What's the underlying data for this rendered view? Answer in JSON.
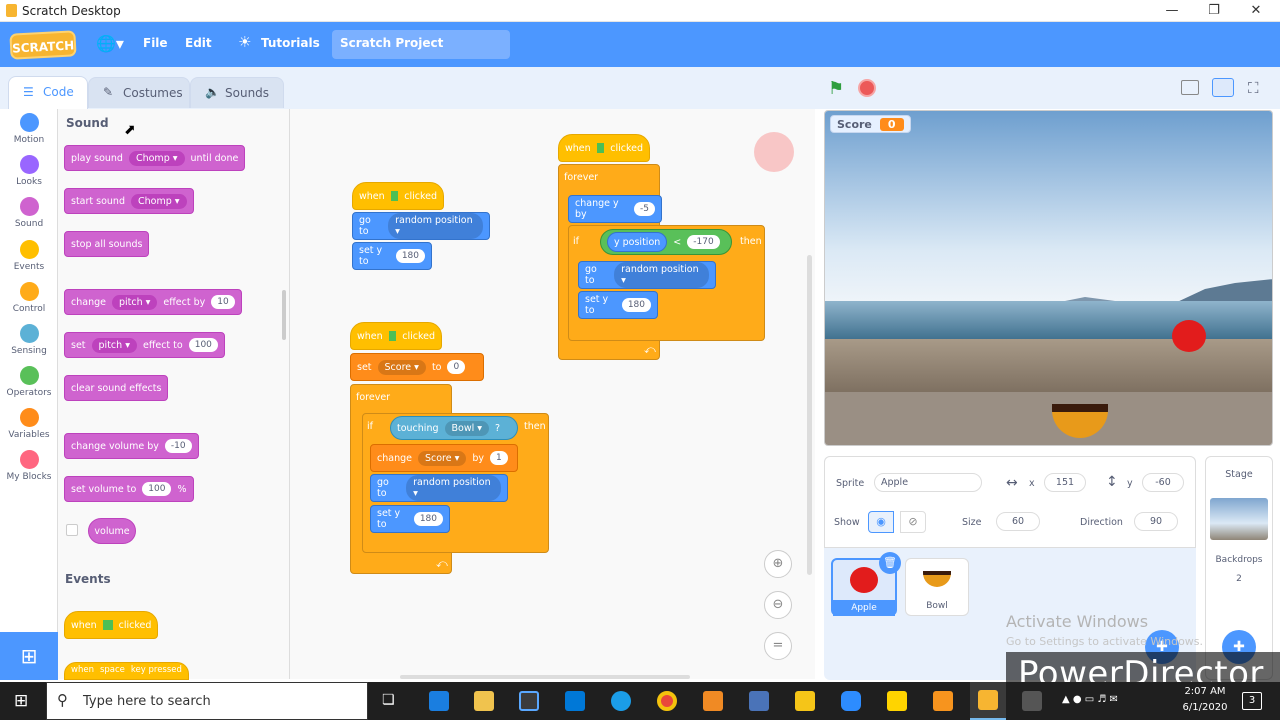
{
  "window": {
    "title": "Scratch Desktop"
  },
  "menubar": {
    "logo": "SCRATCH",
    "file": "File",
    "edit": "Edit",
    "tutorials": "Tutorials",
    "project_title": "Scratch Project"
  },
  "tabs": {
    "code": "Code",
    "costumes": "Costumes",
    "sounds": "Sounds"
  },
  "categories": [
    "Motion",
    "Looks",
    "Sound",
    "Events",
    "Control",
    "Sensing",
    "Operators",
    "Variables",
    "My Blocks"
  ],
  "category_colors": [
    "#4c97ff",
    "#9966ff",
    "#cf63cf",
    "#ffbf00",
    "#ffab19",
    "#5cb1d6",
    "#59c059",
    "#ff8c1a",
    "#ff6680"
  ],
  "palette": {
    "sound_header": "Sound",
    "play_sound": "play sound",
    "chomp": "Chomp",
    "until_done": "until done",
    "start_sound": "start sound",
    "stop_all": "stop all sounds",
    "change": "change",
    "pitch": "pitch",
    "effect_by": "effect by",
    "ten": "10",
    "set": "set",
    "effect_to": "effect to",
    "hundred": "100",
    "clear_effects": "clear sound effects",
    "change_volume_by": "change volume by",
    "minus_ten": "-10",
    "set_volume_to": "set volume to",
    "percent": "%",
    "volume": "volume",
    "events_header": "Events",
    "when": "when",
    "clicked": "clicked",
    "when_space": "when",
    "space": "space",
    "key_pressed": "key pressed"
  },
  "script1": {
    "when": "when",
    "clicked": "clicked",
    "go_to": "go to",
    "random": "random position",
    "set_y": "set y to",
    "y_val": "180"
  },
  "script2": {
    "when": "when",
    "clicked": "clicked",
    "set": "set",
    "score": "Score",
    "to": "to",
    "zero": "0",
    "forever": "forever",
    "if": "if",
    "touching": "touching",
    "bowl": "Bowl",
    "q": "?",
    "then": "then",
    "change": "change",
    "by": "by",
    "one": "1",
    "go_to": "go to",
    "random": "random position",
    "set_y": "set y to",
    "y_val": "180"
  },
  "script3": {
    "when": "when",
    "clicked": "clicked",
    "forever": "forever",
    "change_y": "change y by",
    "minus5": "-5",
    "if": "if",
    "y_position": "y position",
    "lt": "<",
    "minus170": "-170",
    "then": "then",
    "go_to": "go to",
    "random": "random position",
    "set_y": "set y to",
    "y_val": "180"
  },
  "stage": {
    "score_label": "Score",
    "score_value": "0"
  },
  "sprite_info": {
    "sprite_label": "Sprite",
    "sprite_name": "Apple",
    "x_label": "x",
    "x_val": "151",
    "y_label": "y",
    "y_val": "-60",
    "show_label": "Show",
    "size_label": "Size",
    "size_val": "60",
    "direction_label": "Direction",
    "direction_val": "90"
  },
  "sprites": [
    {
      "name": "Apple"
    },
    {
      "name": "Bowl"
    }
  ],
  "stage_pane": {
    "title": "Stage",
    "backdrops_label": "Backdrops",
    "backdrops_count": "2"
  },
  "watermark": {
    "activate": "Activate Windows",
    "goto": "Go to Settings to activate Windows.",
    "powerdirector": "PowerDirector"
  },
  "taskbar": {
    "search_placeholder": "Type here to search",
    "time": "2:07 AM",
    "date": "6/1/2020",
    "notif": "3"
  }
}
